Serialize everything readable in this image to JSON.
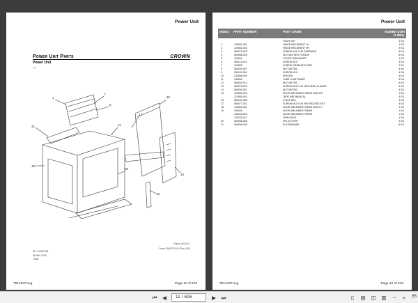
{
  "left_page": {
    "header": "Power Unit",
    "title": "Power Unit Parts",
    "subtitle": "Power Unit",
    "subline": "—",
    "logo": "CROWN",
    "figure_label": "Figure 10115-01",
    "figure_code": "Crown SM079-010 V Rev. 8/15",
    "side_notes": [
      "SL 3 1000 3/5",
      "SI Rev. 6/15",
      "7046"
    ],
    "footer_left": "7914337.svg",
    "footer_right": "Page 11 of 616",
    "callouts": [
      "21",
      "1",
      "7",
      "6",
      "18",
      "11",
      "17",
      "15",
      "20",
      "16",
      "14",
      "10",
      "13",
      "12",
      "3",
      "2",
      "5",
      "4",
      "8",
      "9",
      "19"
    ]
  },
  "right_page": {
    "header": "Power Unit",
    "columns": {
      "index": "INDEX",
      "part": "PART NUMBER",
      "name": "PART NAME",
      "qty": "NUMBE UOM\nR REQ."
    },
    "rows": [
      {
        "index": "",
        "part": "",
        "name": "Power unit",
        "qty": "1 EA"
      },
      {
        "index": "1",
        "part": "120632-001",
        "name": "HINGE WELDMENT LH",
        "qty": "1 EA"
      },
      {
        "index": "2",
        "part": "120652-003",
        "name": "HINGE WELDMENT RH",
        "qty": "2 EA"
      },
      {
        "index": "3",
        "part": "060070-023",
        "name": "SCREW M10 X 35 CARRIAGE",
        "qty": "6 EA"
      },
      {
        "index": "4",
        "part": "060058-025",
        "name": "NUT M10 HEX FLANGE",
        "qty": "6 EA"
      },
      {
        "index": "5",
        "part": "137644",
        "name": "COVER WELDMENT",
        "qty": "1 EA"
      },
      {
        "index": "6",
        "part": "060111-014",
        "name": "SCREW M10",
        "qty": "4 EA"
      },
      {
        "index": "7",
        "part": "104525",
        "name": "SCREW GRUB WITH PAD",
        "qty": "2 EA"
      },
      {
        "index": "8",
        "part": "060030-007",
        "name": "NUT METRIC",
        "qty": "6 EA"
      },
      {
        "index": "9",
        "part": "060111-006",
        "name": "SCREW M10",
        "qty": "4 EA"
      },
      {
        "index": "10",
        "part": "132646-003",
        "name": "SPACER",
        "qty": "6 EA"
      },
      {
        "index": "11",
        "part": "135060",
        "name": "TUBE ELASTOMER",
        "qty": "4 EA"
      },
      {
        "index": "12",
        "part": "060030-012",
        "name": "NUT METRIC",
        "qty": "6 EA"
      },
      {
        "index": "13",
        "part": "060075-022",
        "name": "SCREW M10 X 40 HEX HEAD FLANGE",
        "qty": "4 EA"
      },
      {
        "index": "14",
        "part": "060030-007",
        "name": "NUT METRIC",
        "qty": "4 EA"
      },
      {
        "index": "15",
        "part": "123554-003",
        "name": "DOOR WELDMENT REAR SIDE RH",
        "qty": "1 EA"
      },
      {
        "index": "",
        "part": "123555-002",
        "name": "TAPE MECHANICAL",
        "qty": "6 EA"
      },
      {
        "index": "16",
        "part": "060102-006",
        "name": "U-NUT M10",
        "qty": "4 EA"
      },
      {
        "index": "17",
        "part": "060077-021",
        "name": "SCREW M10 X 40 HEX RECESS SET",
        "qty": "6 EA"
      },
      {
        "index": "18",
        "part": "123554-001",
        "name": "DOOR WELDMENT REAR SIDE LH",
        "qty": "1 EA"
      },
      {
        "index": "19",
        "part": "135006",
        "name": "DOOR WELDMENT REAR",
        "qty": "1 EA"
      },
      {
        "index": "",
        "part": "135033-003",
        "name": "DOOR WELDMENT REAR",
        "qty": "1 EA"
      },
      {
        "index": "",
        "part": "120232-017",
        "name": "TRIM EDGE",
        "qty": "1 EA"
      },
      {
        "index": "20",
        "part": "060038-006",
        "name": "PIN COTTER",
        "qty": "2 EA"
      },
      {
        "index": "21",
        "part": "060056-026",
        "name": "FLATWASHER",
        "qty": "6 EA"
      }
    ],
    "footer_left": "7914337.svg",
    "footer_right": "Page 12 of 616"
  },
  "toolbar": {
    "current_page": "11",
    "page_sep": "/",
    "total_pages": "616",
    "zoom": "65"
  }
}
